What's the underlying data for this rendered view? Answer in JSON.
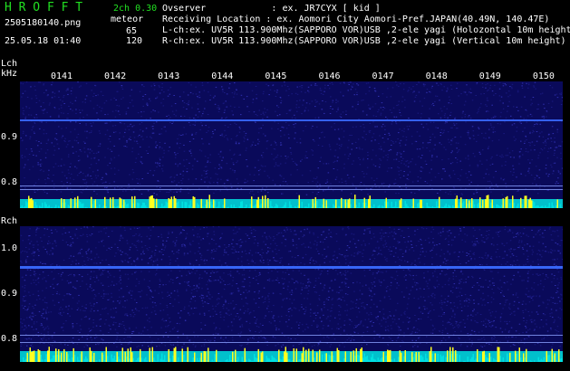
{
  "header": {
    "app_title": "H R O F F T",
    "version": "2ch 0.30",
    "filename": "2505180140.png",
    "datetime": "25.05.18 01:40",
    "mode": "meteor",
    "count_l": "65",
    "count_r": "120",
    "observer_line": "Ovserver            : ex. JR7CYX [ kid ]",
    "location_line": "Receiving Location : ex. Aomori City Aomori-Pref.JAPAN(40.49N, 140.47E)",
    "lch_line": "L-ch:ex. UV5R 113.900Mhz(SAPPORO VOR)USB ,2-ele yagi (Holozontal 10m height)",
    "rch_line": "R-ch:ex. UV5R 113.900Mhz(SAPPORO VOR)USB ,2-ele yagi (Vertical 10m height)"
  },
  "lch": {
    "label": "Lch",
    "unit": "kHz",
    "ticks": [
      "0.9",
      "0.8"
    ]
  },
  "rch": {
    "label": "Rch",
    "ticks": [
      "1.0",
      "0.9",
      "0.8"
    ]
  },
  "time_ticks": [
    "0141",
    "0142",
    "0143",
    "0144",
    "0145",
    "0146",
    "0147",
    "0148",
    "0149",
    "0150"
  ],
  "colors": {
    "background": "#000000",
    "waterfall": "#0a0a5a",
    "signal": "#3a6aff",
    "bar_cyan": "#00e0e0",
    "bar_yellow": "#ffff20",
    "title_green": "#22e022"
  }
}
